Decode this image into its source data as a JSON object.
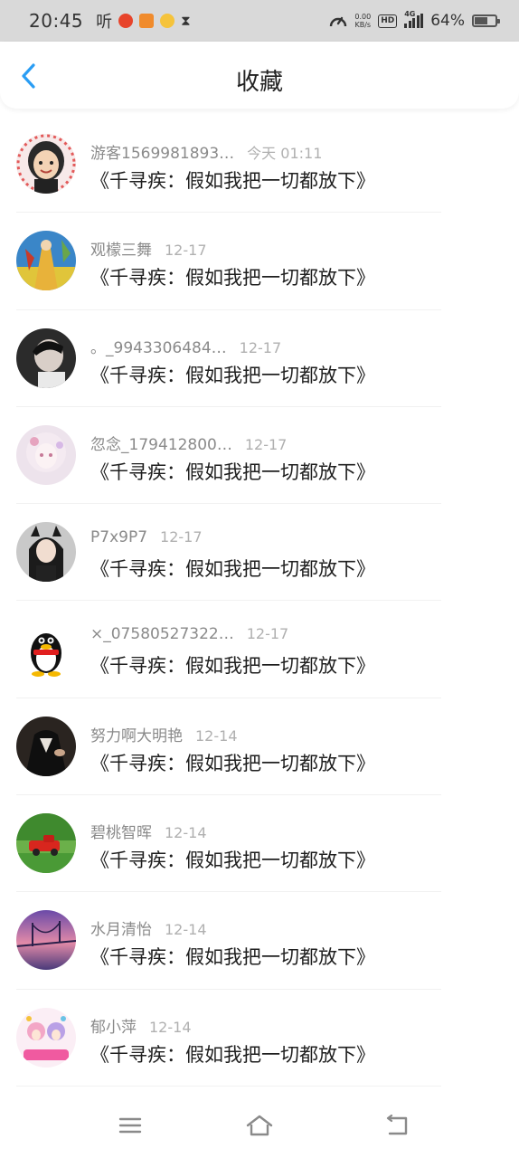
{
  "status_bar": {
    "time": "20:45",
    "ting": "听",
    "net_speed_value": "0.00",
    "net_speed_unit": "KB/s",
    "hd": "HD",
    "network": "4G",
    "battery": "64%"
  },
  "header": {
    "title": "收藏"
  },
  "favorites": [
    {
      "user": "游客1569981893…",
      "date": "今天 01:11",
      "title": "《千寻疾：假如我把一切都放下》",
      "avatar": "cartoon-girl"
    },
    {
      "user": "观檬三舞",
      "date": "12-17",
      "title": "《千寻疾：假如我把一切都放下》",
      "avatar": "painting"
    },
    {
      "user": "。_9943306484…",
      "date": "12-17",
      "title": "《千寻疾：假如我把一切都放下》",
      "avatar": "boy-dark"
    },
    {
      "user": "忽念_179412800…",
      "date": "12-17",
      "title": "《千寻疾：假如我把一切都放下》",
      "avatar": "anime-pink"
    },
    {
      "user": "P7x9P7",
      "date": "12-17",
      "title": "《千寻疾：假如我把一切都放下》",
      "avatar": "girl-cat-ears"
    },
    {
      "user": "×_07580527322…",
      "date": "12-17",
      "title": "《千寻疾：假如我把一切都放下》",
      "avatar": "qq-penguin"
    },
    {
      "user": "努力啊大明艳",
      "date": "12-14",
      "title": "《千寻疾：假如我把一切都放下》",
      "avatar": "suit-dark"
    },
    {
      "user": "碧桃智晖",
      "date": "12-14",
      "title": "《千寻疾：假如我把一切都放下》",
      "avatar": "red-car-grass"
    },
    {
      "user": "水月清怡",
      "date": "12-14",
      "title": "《千寻疾：假如我把一切都放下》",
      "avatar": "sunset-bridge"
    },
    {
      "user": "郁小萍",
      "date": "12-14",
      "title": "《千寻疾：假如我把一切都放下》",
      "avatar": "anime-colorful"
    }
  ],
  "colors": {
    "accent": "#2a9df4",
    "status_bar_bg": "#d9d9d9"
  },
  "nav_bar": {
    "icons": [
      "menu-icon",
      "home-icon",
      "back-nav-icon"
    ]
  }
}
